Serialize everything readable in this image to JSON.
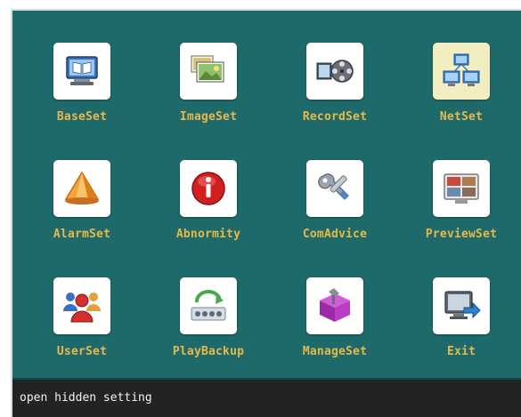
{
  "menu": {
    "items": [
      {
        "label": "BaseSet",
        "icon": "monitor-book-icon",
        "selected": false
      },
      {
        "label": "ImageSet",
        "icon": "image-stack-icon",
        "selected": false
      },
      {
        "label": "RecordSet",
        "icon": "film-reel-icon",
        "selected": false
      },
      {
        "label": "NetSet",
        "icon": "network-computers-icon",
        "selected": true
      },
      {
        "label": "AlarmSet",
        "icon": "alarm-cone-icon",
        "selected": false
      },
      {
        "label": "Abnormity",
        "icon": "info-warning-icon",
        "selected": false
      },
      {
        "label": "ComAdvice",
        "icon": "tools-wrench-icon",
        "selected": false
      },
      {
        "label": "PreviewSet",
        "icon": "preview-screen-icon",
        "selected": false
      },
      {
        "label": "UserSet",
        "icon": "users-icon",
        "selected": false
      },
      {
        "label": "PlayBackup",
        "icon": "playback-backup-icon",
        "selected": false
      },
      {
        "label": "ManageSet",
        "icon": "manage-box-icon",
        "selected": false
      },
      {
        "label": "Exit",
        "icon": "exit-monitor-icon",
        "selected": false
      }
    ]
  },
  "status": {
    "text": "open hidden setting"
  },
  "colors": {
    "background": "#1e6a6a",
    "label": "#e8b84a",
    "status_bar": "#232323",
    "selected_tile": "#f3eec2"
  }
}
